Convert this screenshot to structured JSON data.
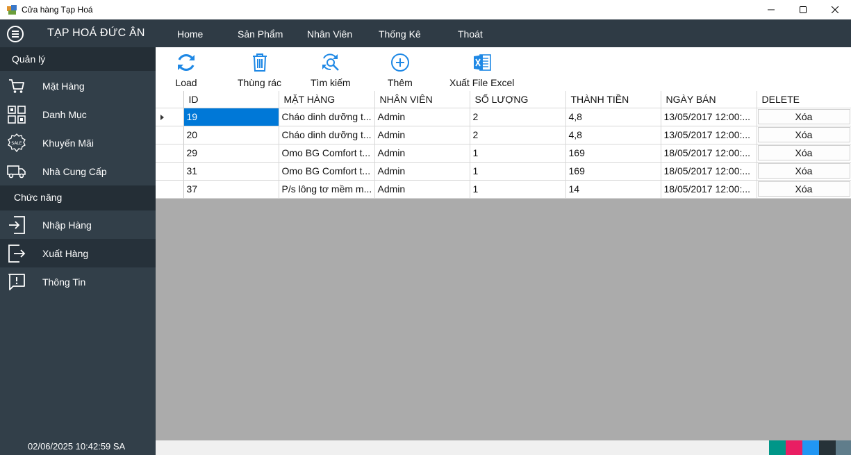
{
  "window": {
    "title": "Cửa hàng Tạp Hoá"
  },
  "topnav": {
    "brand": "TẠP HOÁ ĐỨC ÂN",
    "items": [
      "Home",
      "Sản Phẩm",
      "Nhân Viên",
      "Thống Kê",
      "Thoát"
    ]
  },
  "sidebar": {
    "section_manage": "Quản lý",
    "manage_items": [
      {
        "label": "Mặt Hàng",
        "icon": "cart-icon"
      },
      {
        "label": "Danh Mục",
        "icon": "grid-icon"
      },
      {
        "label": "Khuyến Mãi",
        "icon": "sale-badge-icon"
      },
      {
        "label": "Nhà Cung Cấp",
        "icon": "truck-icon"
      }
    ],
    "section_function": "Chức năng",
    "function_items": [
      {
        "label": "Nhập Hàng",
        "icon": "sign-in-icon"
      },
      {
        "label": "Xuất Hàng",
        "icon": "sign-out-icon"
      },
      {
        "label": "Thông Tin",
        "icon": "info-message-icon"
      }
    ],
    "clock": "02/06/2025 10:42:59 SA"
  },
  "toolbar": {
    "load": "Load",
    "trash": "Thùng rác",
    "search": "Tìm kiếm",
    "add": "Thêm",
    "export": "Xuất File Excel"
  },
  "grid": {
    "columns": [
      "ID",
      "MẶT HÀNG",
      "NHÂN VIÊN",
      "SỐ LƯỢNG",
      "THÀNH TIỀN",
      "NGÀY BÁN",
      "DELETE"
    ],
    "rows": [
      {
        "id": "19",
        "item": "Cháo dinh dưỡng t...",
        "staff": "Admin",
        "qty": "2",
        "total": "4,8",
        "date": "13/05/2017 12:00:...",
        "delete": "Xóa"
      },
      {
        "id": "20",
        "item": "Cháo dinh dưỡng t...",
        "staff": "Admin",
        "qty": "2",
        "total": "4,8",
        "date": "13/05/2017 12:00:...",
        "delete": "Xóa"
      },
      {
        "id": "29",
        "item": "Omo BG Comfort t...",
        "staff": "Admin",
        "qty": "1",
        "total": "169",
        "date": "18/05/2017 12:00:...",
        "delete": "Xóa"
      },
      {
        "id": "31",
        "item": "Omo BG Comfort t...",
        "staff": "Admin",
        "qty": "1",
        "total": "169",
        "date": "18/05/2017 12:00:...",
        "delete": "Xóa"
      },
      {
        "id": "37",
        "item": "P/s lông tơ mềm m...",
        "staff": "Admin",
        "qty": "1",
        "total": "14",
        "date": "18/05/2017 12:00:...",
        "delete": "Xóa"
      }
    ]
  },
  "colors": {
    "nav_bg": "#2f3b45",
    "sidebar_bg": "#323f49",
    "section_bg": "#242e36",
    "accent": "#1e88e5",
    "selection": "#0078d7",
    "grid_bg": "#ababab",
    "theme_swatches": [
      "#009688",
      "#e91e63",
      "#2196f3",
      "#263238",
      "#607d8b"
    ]
  }
}
